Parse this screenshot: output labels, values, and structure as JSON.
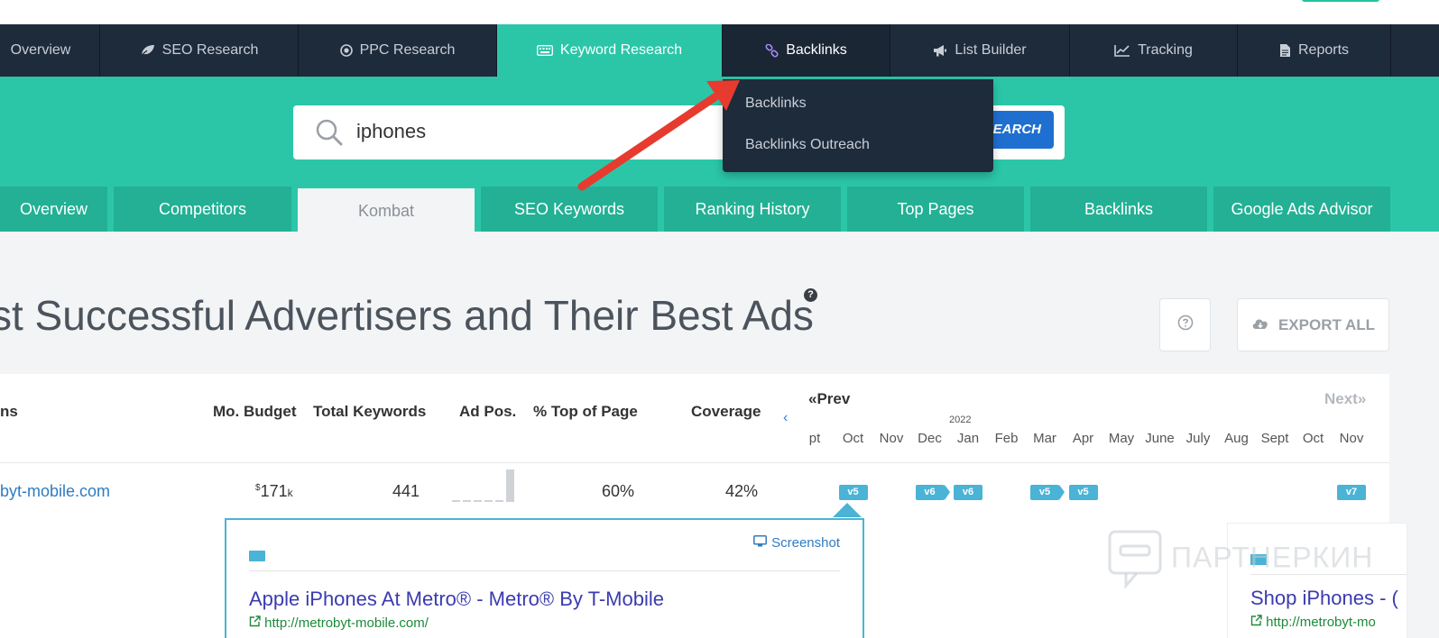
{
  "main_nav": {
    "items": [
      {
        "label": "Overview",
        "icon": "none"
      },
      {
        "label": "SEO Research",
        "icon": "leaf-icon"
      },
      {
        "label": "PPC Research",
        "icon": "target-icon"
      },
      {
        "label": "Keyword Research",
        "icon": "keyboard-icon"
      },
      {
        "label": "Backlinks",
        "icon": "link-icon"
      },
      {
        "label": "List Builder",
        "icon": "megaphone-icon"
      },
      {
        "label": "Tracking",
        "icon": "chart-line-icon"
      },
      {
        "label": "Reports",
        "icon": "document-icon"
      }
    ],
    "active": "Keyword Research",
    "open": "Backlinks"
  },
  "dropdown": {
    "items": [
      "Backlinks",
      "Backlinks Outreach"
    ]
  },
  "search": {
    "value": "iphones",
    "button_label": "SEARCH"
  },
  "sub_tabs": {
    "items": [
      "Overview",
      "Competitors",
      "Kombat",
      "SEO Keywords",
      "Ranking History",
      "Top Pages",
      "Backlinks",
      "Google Ads Advisor"
    ],
    "active": "Kombat"
  },
  "heading": {
    "title": "st Successful Advertisers and Their Best Ads",
    "help_mark": "?"
  },
  "actions": {
    "export_label": "EXPORT ALL"
  },
  "table": {
    "columns": [
      "ns",
      "Mo. Budget",
      "Total Keywords",
      "Ad Pos.",
      "% Top of Page",
      "Coverage"
    ],
    "timeline": {
      "prev_label": "Prev",
      "next_label": "Next",
      "year_label": "2022",
      "months": [
        "pt",
        "Oct",
        "Nov",
        "Dec",
        "Jan",
        "Feb",
        "Mar",
        "Apr",
        "May",
        "June",
        "July",
        "Aug",
        "Sept",
        "Oct",
        "Nov"
      ]
    },
    "rows": [
      {
        "domain": "byt-mobile.com",
        "budget_prefix": "$",
        "budget_value": "171",
        "budget_suffix": "k",
        "total_keywords": "441",
        "ad_pos_bars": [
          0.05,
          0.05,
          0.05,
          0.05,
          0.05,
          1.0
        ],
        "top_of_page": "60%",
        "coverage": "42%",
        "versions": [
          {
            "month_index": 1,
            "label": "v5",
            "tail": false
          },
          {
            "month_index": 3,
            "label": "v6",
            "tail": true
          },
          {
            "month_index": 4,
            "label": "v6",
            "tail": false
          },
          {
            "month_index": 6,
            "label": "v5",
            "tail": true
          },
          {
            "month_index": 7,
            "label": "v5",
            "tail": false
          },
          {
            "month_index": 14,
            "label": "v7",
            "tail": false
          }
        ]
      }
    ]
  },
  "ad_preview": {
    "screenshot_label": "Screenshot",
    "title": "Apple iPhones At Metro® - Metro® By T-Mobile",
    "url": "http://metrobyt-mobile.com/"
  },
  "ad_preview_2": {
    "title": "Shop iPhones - (",
    "url": "http://metrobyt-mo"
  },
  "watermark": "ПАРТНЕРКИН",
  "colors": {
    "nav_bg": "#1e2b3b",
    "teal": "#2bc6a8",
    "teal_dark": "#23b094",
    "link_blue": "#2f7cc1",
    "badge_blue": "#4ab3d6",
    "arrow_red": "#e63b2e"
  }
}
